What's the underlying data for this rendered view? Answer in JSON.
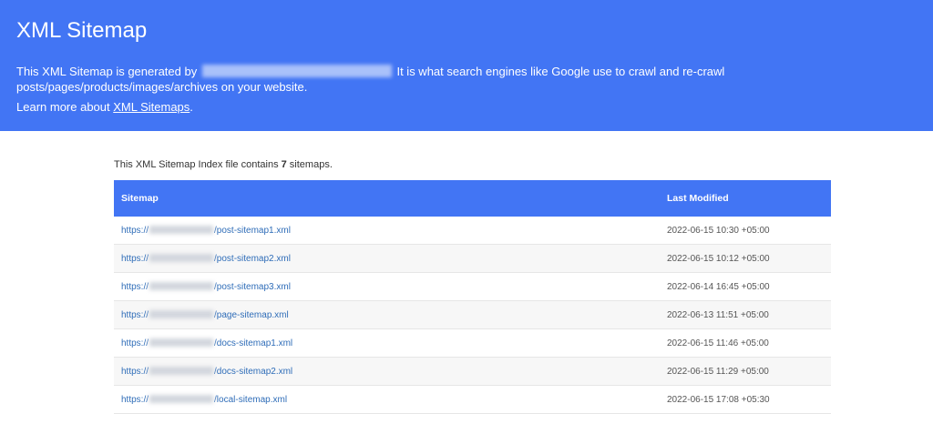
{
  "header": {
    "title": "XML Sitemap",
    "intro_before": "This XML Sitemap is generated by",
    "intro_after": " It is what search engines like Google use to crawl and re-crawl posts/pages/products/images/archives on your website.",
    "learn_prefix": "Learn more about ",
    "learn_link": "XML Sitemaps",
    "learn_suffix": "."
  },
  "summary": {
    "prefix": "This XML Sitemap Index file contains ",
    "count": "7",
    "suffix": " sitemaps."
  },
  "table": {
    "columns": [
      "Sitemap",
      "Last Modified"
    ],
    "rows": [
      {
        "prefix": "https://",
        "path": "/post-sitemap1.xml",
        "modified": "2022-06-15 10:30 +05:00"
      },
      {
        "prefix": "https://",
        "path": "/post-sitemap2.xml",
        "modified": "2022-06-15 10:12 +05:00"
      },
      {
        "prefix": "https://",
        "path": "/post-sitemap3.xml",
        "modified": "2022-06-14 16:45 +05:00"
      },
      {
        "prefix": "https://",
        "path": "/page-sitemap.xml",
        "modified": "2022-06-13 11:51 +05:00"
      },
      {
        "prefix": "https://",
        "path": "/docs-sitemap1.xml",
        "modified": "2022-06-15 11:46 +05:00"
      },
      {
        "prefix": "https://",
        "path": "/docs-sitemap2.xml",
        "modified": "2022-06-15 11:29 +05:00"
      },
      {
        "prefix": "https://",
        "path": "/local-sitemap.xml",
        "modified": "2022-06-15 17:08 +05:30"
      }
    ]
  },
  "colors": {
    "accent": "#4275f4",
    "link": "#2f6db8",
    "stripe": "#f7f7f7"
  }
}
